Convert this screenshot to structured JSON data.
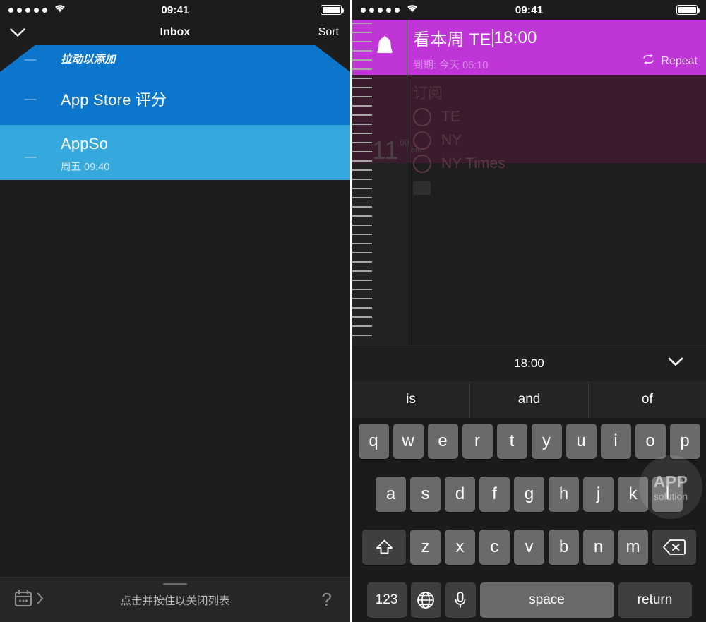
{
  "left_phone": {
    "status_bar": {
      "time": "09:41",
      "signal_dots": 5,
      "wifi_icon": "wifi-icon",
      "battery_icon": "battery-full-icon"
    },
    "nav": {
      "back_icon": "chevron-down-icon",
      "title": "Inbox",
      "sort_label": "Sort"
    },
    "list": {
      "pull_to_add": {
        "dash": "—",
        "label": "拉动以添加"
      },
      "items": [
        {
          "dash": "—",
          "title": "App Store 评分",
          "subtitle": ""
        },
        {
          "dash": "—",
          "title": "AppSo",
          "subtitle": "周五 09:40"
        }
      ]
    },
    "bottom_bar": {
      "calendar_icon": "calendar-icon",
      "chevron_icon": "chevron-right-icon",
      "hint": "点击并按住以关闭列表",
      "help_label": "?"
    }
  },
  "right_phone": {
    "status_bar": {
      "time": "09:41",
      "signal_dots": 5,
      "wifi_icon": "wifi-icon",
      "battery_icon": "battery-full-icon"
    },
    "event": {
      "bell_icon": "bell-icon",
      "title_before_caret": "看本周 TE",
      "title_after_caret": "18:00",
      "due_label": "到期: 今天 06:10",
      "repeat_icon": "repeat-icon",
      "repeat_label": "Repeat"
    },
    "dimmed_event": {
      "heading": "订阅",
      "options": [
        "TE",
        "NY",
        "NY Times"
      ],
      "attachment_icon": "image-thumbnail-icon"
    },
    "ruler": {
      "hour": "11",
      "minute": "00",
      "ampm": "am"
    },
    "time_bar": {
      "value": "18:00",
      "collapse_icon": "chevron-down-icon"
    },
    "suggestions": [
      "is",
      "and",
      "of"
    ],
    "keyboard": {
      "row1": [
        "q",
        "w",
        "e",
        "r",
        "t",
        "y",
        "u",
        "i",
        "o",
        "p"
      ],
      "row2": [
        "a",
        "s",
        "d",
        "f",
        "g",
        "h",
        "j",
        "k",
        "l"
      ],
      "row3_shift_icon": "shift-icon",
      "row3": [
        "z",
        "x",
        "c",
        "v",
        "b",
        "n",
        "m"
      ],
      "row3_backspace_icon": "backspace-icon",
      "row4": {
        "numbers_label": "123",
        "globe_icon": "globe-icon",
        "mic_icon": "microphone-icon",
        "space_label": "space",
        "return_label": "return"
      }
    },
    "watermark": {
      "line1": "APP",
      "line2": "solution"
    }
  },
  "colors": {
    "accent_blue_dark": "#0b76cb",
    "accent_blue_light": "#35a8dd",
    "accent_purple": "#bf35d8",
    "dim_maroon": "#3a1c2e",
    "background_dark": "#1d1d1d"
  }
}
